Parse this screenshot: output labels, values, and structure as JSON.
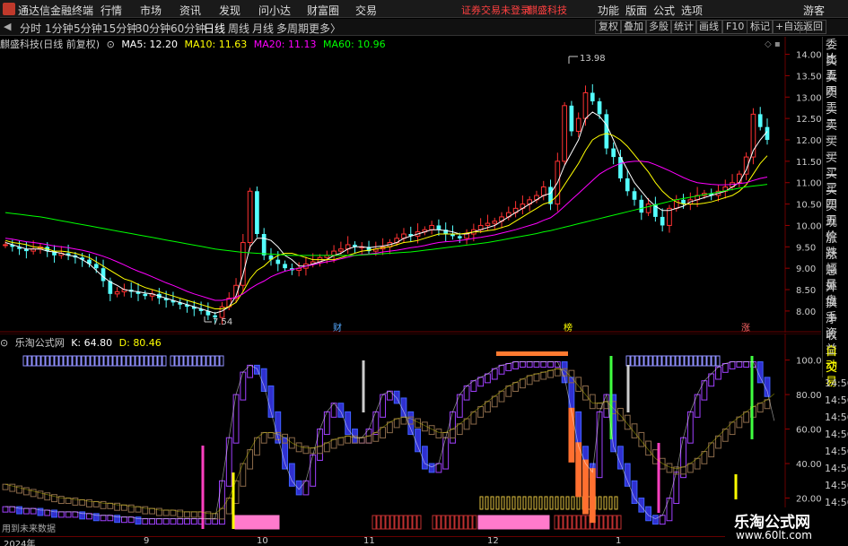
{
  "titlebar": {
    "app_title": "通达信金融终端",
    "menus": [
      "行情",
      "市场",
      "资讯",
      "发现",
      "问小达",
      "财富圈",
      "交易"
    ],
    "warning": "证券交易未登录",
    "stock_name": "麒盛科技",
    "right_menus": [
      "功能",
      "版面",
      "公式",
      "选项"
    ],
    "guest": "游客"
  },
  "tabbar": {
    "arrow": "◀",
    "tabs": [
      "分时",
      "1分钟",
      "5分钟",
      "15分钟",
      "30分钟",
      "60分钟",
      "日线",
      "周线",
      "月线",
      "多周期",
      "更多〉"
    ],
    "active_tab": "日线",
    "right_buttons": [
      "复权",
      "叠加",
      "多股",
      "统计",
      "画线",
      "F10",
      "标记",
      "+自选",
      "返回"
    ]
  },
  "chart_head": {
    "title": "麒盛科技(日线 前复权)",
    "ma5": "MA5: 12.20",
    "ma10": "MA10: 11.63",
    "ma20": "MA20: 11.13",
    "ma60": "MA60: 10.96"
  },
  "ind_head": {
    "title": "乐淘公式网",
    "k": "K: 64.80",
    "d": "D: 80.46"
  },
  "right_panel": [
    "委比",
    "卖五",
    "卖四",
    "卖三",
    "卖二",
    "卖一",
    "买一",
    "买二",
    "买三",
    "买四",
    "买五",
    "现价",
    "涨跌",
    "涨幅",
    "总量",
    "外盘",
    "换手",
    "净资",
    "收益",
    "自动",
    "交易"
  ],
  "right_times": [
    "14:56",
    "14:56",
    "14:56",
    "14:56",
    "14:56",
    "14:56",
    "14:56",
    "14:56",
    "14:56"
  ],
  "main_axis": [
    "14.00",
    "13.50",
    "13.00",
    "12.50",
    "12.00",
    "11.50",
    "11.00",
    "10.50",
    "10.00",
    "9.50",
    "9.00",
    "8.50",
    "8.00"
  ],
  "ind_axis": [
    "100.0",
    "80.00",
    "60.00",
    "40.00",
    "20.00"
  ],
  "annotations": {
    "high": "13.98",
    "low": "7.54",
    "m1": "财",
    "m2": "榜",
    "m3": "涨"
  },
  "ind_note": "用到未来数据",
  "bottom_axis": [
    "2024年",
    "9",
    "10",
    "11",
    "12",
    "1"
  ],
  "watermark": {
    "line1": "乐淘公式网",
    "line2": "www.60lt.com"
  },
  "colors": {
    "up": "#ff3232",
    "down": "#54ffff",
    "ma5": "#ffffff",
    "ma10": "#ffff00",
    "ma20": "#ff00ff",
    "ma60": "#00ff00"
  },
  "chart_data": {
    "type": "candlestick",
    "title": "麒盛科技(日线 前复权)",
    "ylim": [
      7.6,
      14.2
    ],
    "closes": [
      9.55,
      9.5,
      9.45,
      9.4,
      9.45,
      9.5,
      9.4,
      9.3,
      9.35,
      9.3,
      9.25,
      9.2,
      9.1,
      9.0,
      8.7,
      8.4,
      8.45,
      8.5,
      8.45,
      8.4,
      8.35,
      8.4,
      8.3,
      8.25,
      8.2,
      8.15,
      8.1,
      8.05,
      8.0,
      7.9,
      7.85,
      8.1,
      8.3,
      8.6,
      9.6,
      10.8,
      9.8,
      9.3,
      9.2,
      9.1,
      9.0,
      8.95,
      9.0,
      9.1,
      9.15,
      9.25,
      9.3,
      9.4,
      9.45,
      9.55,
      9.5,
      9.5,
      9.4,
      9.45,
      9.5,
      9.6,
      9.7,
      9.8,
      9.75,
      9.85,
      9.9,
      10.0,
      9.9,
      9.8,
      9.75,
      9.7,
      9.8,
      9.9,
      10.0,
      10.05,
      10.1,
      10.2,
      10.3,
      10.4,
      10.5,
      10.6,
      10.7,
      10.9,
      10.5,
      11.5,
      12.8,
      12.2,
      12.5,
      13.1,
      12.9,
      12.6,
      11.8,
      11.6,
      11.1,
      10.8,
      10.6,
      10.3,
      10.5,
      10.2,
      10.0,
      10.4,
      10.6,
      10.5,
      10.6,
      10.7,
      10.75,
      10.7,
      10.8,
      10.9,
      11.0,
      11.2,
      11.6,
      12.6,
      12.3,
      12.0
    ],
    "ma5": [
      9.6,
      9.55,
      9.5,
      9.45,
      9.45,
      9.45,
      9.4,
      9.38,
      9.35,
      9.3,
      9.28,
      9.2,
      9.1,
      8.95,
      8.8,
      8.68,
      8.6,
      8.5,
      8.47,
      8.45,
      8.42,
      8.4,
      8.35,
      8.3,
      8.25,
      8.2,
      8.15,
      8.1,
      8.05,
      8.0,
      7.95,
      8.0,
      8.1,
      8.35,
      8.85,
      9.5,
      9.7,
      9.7,
      9.65,
      9.5,
      9.3,
      9.2,
      9.05,
      9.05,
      9.1,
      9.15,
      9.2,
      9.3,
      9.35,
      9.45,
      9.5,
      9.5,
      9.48,
      9.5,
      9.52,
      9.55,
      9.6,
      9.7,
      9.75,
      9.8,
      9.85,
      9.9,
      9.9,
      9.88,
      9.85,
      9.8,
      9.8,
      9.85,
      9.9,
      9.95,
      10.0,
      10.1,
      10.2,
      10.3,
      10.4,
      10.5,
      10.6,
      10.7,
      10.75,
      11.0,
      11.4,
      11.7,
      12.0,
      12.5,
      12.65,
      12.55,
      12.35,
      12.0,
      11.6,
      11.3,
      11.0,
      10.8,
      10.6,
      10.45,
      10.35,
      10.35,
      10.4,
      10.45,
      10.55,
      10.6,
      10.65,
      10.7,
      10.75,
      10.8,
      10.9,
      11.0,
      11.3,
      11.75,
      12.0,
      12.2
    ],
    "ma10": [
      9.65,
      9.6,
      9.58,
      9.55,
      9.5,
      9.48,
      9.45,
      9.4,
      9.4,
      9.38,
      9.35,
      9.3,
      9.25,
      9.15,
      9.05,
      8.95,
      8.85,
      8.75,
      8.7,
      8.62,
      8.55,
      8.5,
      8.45,
      8.4,
      8.35,
      8.3,
      8.25,
      8.2,
      8.15,
      8.1,
      8.05,
      8.05,
      8.1,
      8.2,
      8.45,
      8.75,
      8.95,
      9.05,
      9.2,
      9.3,
      9.35,
      9.35,
      9.3,
      9.25,
      9.2,
      9.2,
      9.2,
      9.2,
      9.25,
      9.3,
      9.35,
      9.4,
      9.42,
      9.45,
      9.48,
      9.5,
      9.55,
      9.6,
      9.62,
      9.65,
      9.7,
      9.75,
      9.8,
      9.8,
      9.8,
      9.8,
      9.82,
      9.85,
      9.85,
      9.88,
      9.9,
      9.95,
      10.0,
      10.1,
      10.2,
      10.3,
      10.4,
      10.5,
      10.55,
      10.7,
      10.95,
      11.2,
      11.45,
      11.75,
      12.0,
      12.1,
      12.15,
      12.1,
      12.0,
      11.85,
      11.65,
      11.45,
      11.25,
      11.0,
      10.8,
      10.65,
      10.55,
      10.5,
      10.5,
      10.5,
      10.52,
      10.55,
      10.6,
      10.65,
      10.7,
      10.8,
      10.95,
      11.2,
      11.45,
      11.63
    ],
    "ma20": [
      9.7,
      9.68,
      9.65,
      9.62,
      9.6,
      9.58,
      9.55,
      9.52,
      9.5,
      9.48,
      9.45,
      9.42,
      9.38,
      9.33,
      9.28,
      9.22,
      9.15,
      9.08,
      9.0,
      8.93,
      8.87,
      8.8,
      8.73,
      8.66,
      8.6,
      8.53,
      8.46,
      8.4,
      8.35,
      8.3,
      8.25,
      8.25,
      8.28,
      8.32,
      8.4,
      8.52,
      8.62,
      8.7,
      8.8,
      8.87,
      8.93,
      8.97,
      9.0,
      9.05,
      9.08,
      9.12,
      9.15,
      9.18,
      9.22,
      9.26,
      9.3,
      9.32,
      9.33,
      9.35,
      9.38,
      9.4,
      9.42,
      9.45,
      9.48,
      9.5,
      9.53,
      9.57,
      9.6,
      9.62,
      9.63,
      9.65,
      9.67,
      9.7,
      9.72,
      9.75,
      9.78,
      9.82,
      9.86,
      9.9,
      9.95,
      10.0,
      10.05,
      10.12,
      10.18,
      10.3,
      10.45,
      10.6,
      10.75,
      10.9,
      11.05,
      11.2,
      11.3,
      11.38,
      11.45,
      11.48,
      11.5,
      11.5,
      11.48,
      11.42,
      11.35,
      11.28,
      11.2,
      11.12,
      11.05,
      11.0,
      10.98,
      10.96,
      10.95,
      10.95,
      10.96,
      10.98,
      11.0,
      11.05,
      11.1,
      11.13
    ],
    "ma60": [
      10.3,
      10.28,
      10.26,
      10.24,
      10.22,
      10.2,
      10.17,
      10.14,
      10.11,
      10.08,
      10.05,
      10.02,
      9.99,
      9.96,
      9.93,
      9.9,
      9.87,
      9.84,
      9.81,
      9.78,
      9.75,
      9.72,
      9.69,
      9.66,
      9.63,
      9.6,
      9.57,
      9.54,
      9.51,
      9.48,
      9.45,
      9.43,
      9.41,
      9.39,
      9.37,
      9.36,
      9.35,
      9.34,
      9.33,
      9.32,
      9.31,
      9.3,
      9.3,
      9.3,
      9.3,
      9.3,
      9.3,
      9.3,
      9.3,
      9.3,
      9.3,
      9.31,
      9.32,
      9.33,
      9.34,
      9.35,
      9.36,
      9.37,
      9.38,
      9.4,
      9.42,
      9.44,
      9.46,
      9.48,
      9.5,
      9.52,
      9.54,
      9.56,
      9.58,
      9.6,
      9.63,
      9.66,
      9.69,
      9.72,
      9.75,
      9.78,
      9.81,
      9.85,
      9.88,
      9.92,
      9.96,
      10.0,
      10.04,
      10.08,
      10.12,
      10.16,
      10.2,
      10.24,
      10.28,
      10.32,
      10.36,
      10.4,
      10.44,
      10.48,
      10.52,
      10.56,
      10.6,
      10.63,
      10.66,
      10.69,
      10.72,
      10.75,
      10.78,
      10.81,
      10.84,
      10.87,
      10.9,
      10.92,
      10.94,
      10.96
    ],
    "indicator": {
      "ylim": [
        0,
        105
      ],
      "k": [
        15,
        15,
        14,
        14,
        14,
        13,
        13,
        12,
        12,
        12,
        12,
        11,
        11,
        10,
        10,
        10,
        9,
        9,
        9,
        8,
        8,
        8,
        8,
        8,
        8,
        8,
        8,
        8,
        8,
        8,
        8,
        30,
        55,
        80,
        93,
        97,
        95,
        85,
        70,
        55,
        40,
        30,
        25,
        30,
        45,
        60,
        70,
        75,
        70,
        60,
        55,
        55,
        60,
        70,
        80,
        82,
        78,
        70,
        60,
        50,
        40,
        38,
        40,
        55,
        70,
        80,
        85,
        88,
        90,
        92,
        95,
        97,
        98,
        99,
        99,
        99,
        99,
        99,
        99,
        99,
        90,
        70,
        50,
        40,
        35,
        70,
        80,
        50,
        40,
        30,
        20,
        15,
        10,
        8,
        10,
        20,
        35,
        55,
        70,
        80,
        88,
        92,
        96,
        98,
        99,
        99,
        99,
        99,
        90,
        82,
        64.8
      ],
      "d": [
        28,
        27,
        26,
        25,
        24,
        23,
        22,
        21,
        20,
        20,
        19,
        19,
        18,
        18,
        17,
        17,
        16,
        16,
        15,
        15,
        14,
        14,
        13,
        13,
        13,
        12,
        12,
        12,
        12,
        11,
        11,
        14,
        20,
        30,
        40,
        48,
        55,
        58,
        58,
        57,
        55,
        52,
        50,
        49,
        49,
        50,
        52,
        54,
        55,
        56,
        55,
        55,
        56,
        58,
        61,
        64,
        66,
        67,
        66,
        64,
        62,
        60,
        58,
        58,
        60,
        63,
        66,
        70,
        73,
        76,
        79,
        82,
        85,
        87,
        89,
        91,
        92,
        93,
        94,
        95,
        94,
        90,
        85,
        80,
        75,
        75,
        76,
        72,
        68,
        63,
        58,
        53,
        48,
        43,
        40,
        38,
        37,
        38,
        40,
        43,
        47,
        52,
        56,
        60,
        64,
        67,
        70,
        73,
        75,
        77,
        80.46
      ]
    }
  }
}
